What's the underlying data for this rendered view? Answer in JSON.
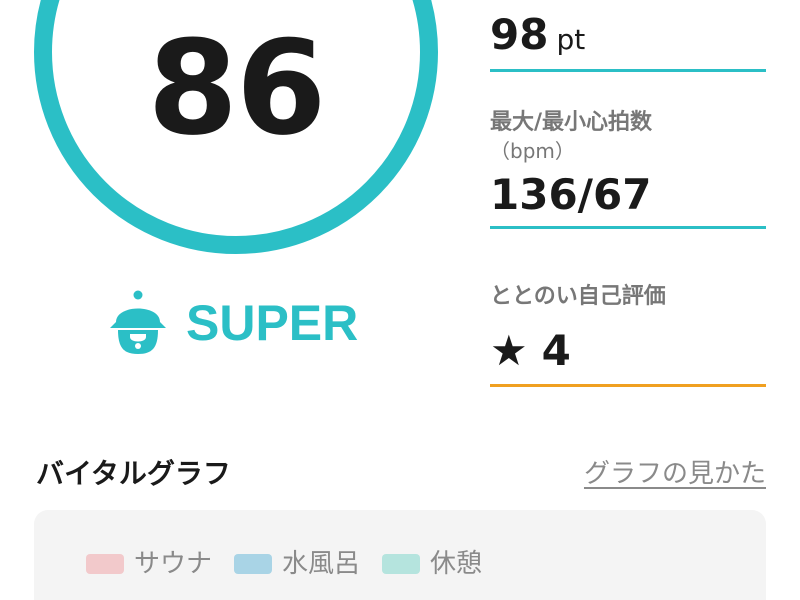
{
  "score": {
    "value": "86",
    "ring_color": "#2bbfc6"
  },
  "rank": {
    "icon": "sauna-hat-person-icon",
    "label": "SUPER",
    "color": "#2bbfc6"
  },
  "metrics": {
    "points": {
      "value": "98",
      "unit": "pt"
    },
    "heart_rate": {
      "label": "最大/最小心拍数",
      "sublabel": "（bpm）",
      "value": "136/67"
    },
    "self_rating": {
      "label": "ととのい自己評価",
      "star": "★",
      "value": "4",
      "accent": "#f0a020"
    }
  },
  "vital_graph": {
    "title": "バイタルグラフ",
    "help_link": "グラフの見かた",
    "legend": [
      {
        "label": "サウナ",
        "color": "#f2c9cb"
      },
      {
        "label": "水風呂",
        "color": "#a9d4e6"
      },
      {
        "label": "休憩",
        "color": "#b5e4de"
      }
    ]
  }
}
